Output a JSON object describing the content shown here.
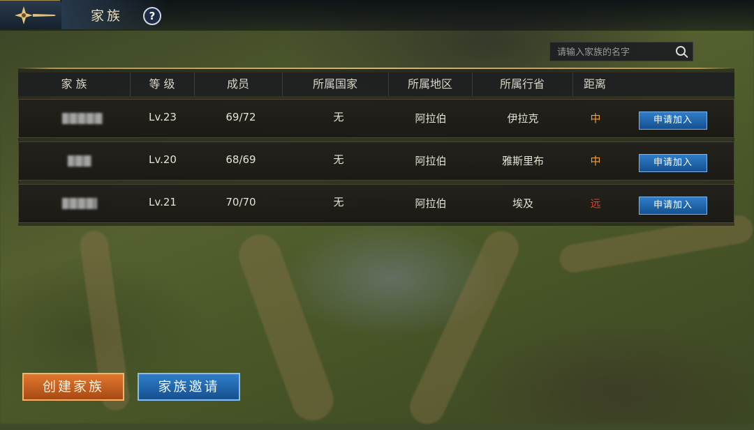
{
  "header": {
    "title": "家族",
    "help_label": "?"
  },
  "search": {
    "placeholder": "请输入家族的名字"
  },
  "table": {
    "columns": [
      "家 族",
      "等 级",
      "成员",
      "所属国家",
      "所属地区",
      "所属行省",
      "距离"
    ],
    "rows": [
      {
        "level": "Lv.23",
        "members": "69/72",
        "country": "无",
        "region": "阿拉伯",
        "province": "伊拉克",
        "distance": "中",
        "action": "申请加入"
      },
      {
        "level": "Lv.20",
        "members": "68/69",
        "country": "无",
        "region": "阿拉伯",
        "province": "雅斯里布",
        "distance": "中",
        "action": "申请加入"
      },
      {
        "level": "Lv.21",
        "members": "70/70",
        "country": "无",
        "region": "阿拉伯",
        "province": "埃及",
        "distance": "远",
        "action": "申请加入"
      }
    ]
  },
  "footer": {
    "create_label": "创建家族",
    "invite_label": "家族邀请"
  },
  "colors": {
    "distance_mid": "#f0a13a",
    "distance_far": "#e2402f",
    "accent_gold": "#d9b66e",
    "button_blue": "#2f7ec9",
    "button_orange": "#e0782f"
  },
  "icons": {
    "crest": "ornate-cross-icon",
    "search": "search-icon",
    "help": "question-mark-icon"
  }
}
